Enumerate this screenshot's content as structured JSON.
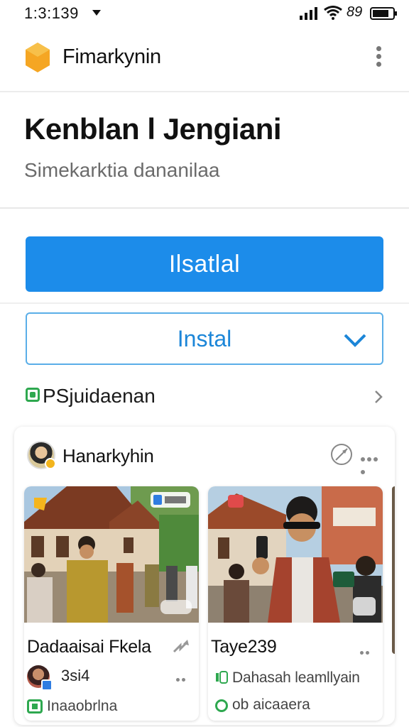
{
  "status_bar": {
    "time": "1:3:139",
    "battery_text": "89"
  },
  "app_bar": {
    "title": "Fimarkynin"
  },
  "header": {
    "title": "Kenblan l Jengiani",
    "subtitle": "Simekarktia dananilaa"
  },
  "primary_button": {
    "label": "Ilsatlal"
  },
  "install_select": {
    "label": "Instal"
  },
  "section": {
    "label": "PSjuidaenan"
  },
  "feed": {
    "author": "Hanarkyhin",
    "posts": [
      {
        "title": "Dadaaisai Fkela",
        "meta": "3si4",
        "footer": "Inaaobrlna"
      },
      {
        "title": "Taye239",
        "subtitle": "Dahasah leamllyain",
        "footer": "ob aicaaera"
      }
    ]
  },
  "colors": {
    "accent": "#1c8cea",
    "select_border": "#5aaee8",
    "brand_logo": "#f5a623",
    "green": "#2ea84f"
  },
  "icons": [
    "dropdown-arrow-icon",
    "signal-icon",
    "wifi-icon",
    "battery-icon",
    "app-logo-icon",
    "kebab-menu-icon",
    "check-icon",
    "section-icon",
    "chevron-right-icon",
    "compass-icon",
    "more-icon",
    "share-icon"
  ]
}
